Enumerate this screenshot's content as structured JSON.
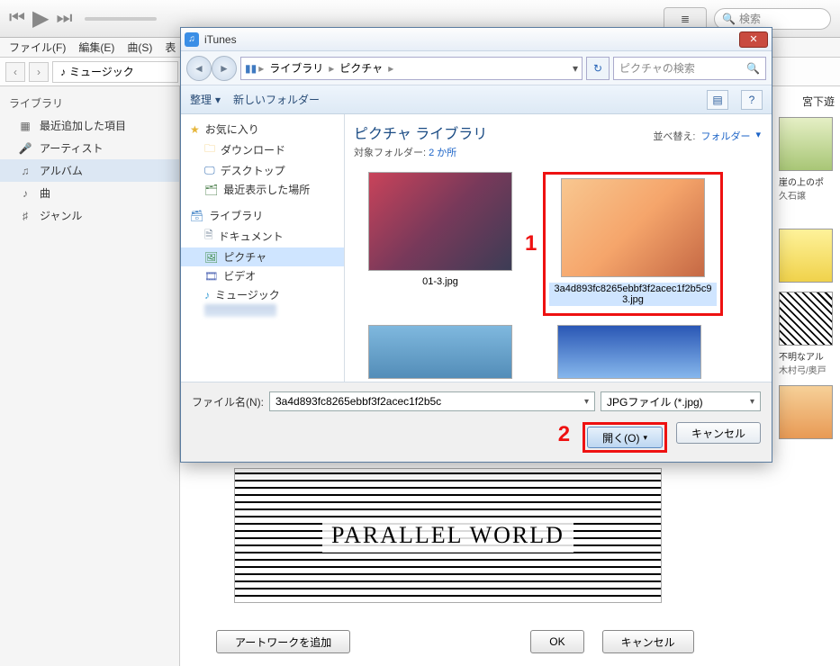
{
  "toolbar": {
    "search_placeholder": "検索"
  },
  "menubar": {
    "file": "ファイル(F)",
    "edit": "編集(E)",
    "song": "曲(S)",
    "view": "表"
  },
  "nav": {
    "dropdown": "ミュージック"
  },
  "sidebar": {
    "header": "ライブラリ",
    "items": [
      {
        "icon": "calendar",
        "label": "最近追加した項目"
      },
      {
        "icon": "mic",
        "label": "アーティスト"
      },
      {
        "icon": "album",
        "label": "アルバム"
      },
      {
        "icon": "note",
        "label": "曲"
      },
      {
        "icon": "genre",
        "label": "ジャンル"
      }
    ]
  },
  "right_column": {
    "artist": "宮下遊",
    "albums": [
      {
        "title": "崖の上のポ",
        "artist": "久石譲"
      },
      {
        "title": "",
        "artist": ""
      },
      {
        "title": "不明なアル",
        "artist": "木村弓/奥戸"
      }
    ]
  },
  "bottom_bar": {
    "add_artwork": "アートワークを追加",
    "ok": "OK",
    "cancel": "キャンセル"
  },
  "artwork_title": "PARALLEL WORLD",
  "dialog": {
    "title": "iTunes",
    "breadcrumb": [
      "ライブラリ",
      "ピクチャ"
    ],
    "search_placeholder": "ピクチャの検索",
    "cmd_organize": "整理",
    "cmd_new_folder": "新しいフォルダー",
    "tree": {
      "favorites": "お気に入り",
      "favorites_items": [
        {
          "icon": "folder",
          "label": "ダウンロード"
        },
        {
          "icon": "monitor",
          "label": "デスクトップ"
        },
        {
          "icon": "clock",
          "label": "最近表示した場所"
        }
      ],
      "libraries": "ライブラリ",
      "libraries_items": [
        {
          "icon": "doc",
          "label": "ドキュメント"
        },
        {
          "icon": "pic",
          "label": "ピクチャ"
        },
        {
          "icon": "video",
          "label": "ビデオ"
        },
        {
          "icon": "music",
          "label": "ミュージック"
        }
      ]
    },
    "location_title": "ピクチャ ライブラリ",
    "location_sub_label": "対象フォルダー:",
    "location_sub_link": "2 か所",
    "sort_label": "並べ替え:",
    "sort_value": "フォルダー",
    "thumbs": [
      {
        "name": "01-3.jpg",
        "selected": false
      },
      {
        "name": "3a4d893fc8265ebbf3f2acec1f2b5c93.jpg",
        "selected": true
      }
    ],
    "filename_label": "ファイル名(N):",
    "filename_value": "3a4d893fc8265ebbf3f2acec1f2b5c",
    "filetype_value": "JPGファイル (*.jpg)",
    "open_button": "開く(O)",
    "cancel_button": "キャンセル",
    "annotations": {
      "one": "1",
      "two": "2"
    }
  }
}
